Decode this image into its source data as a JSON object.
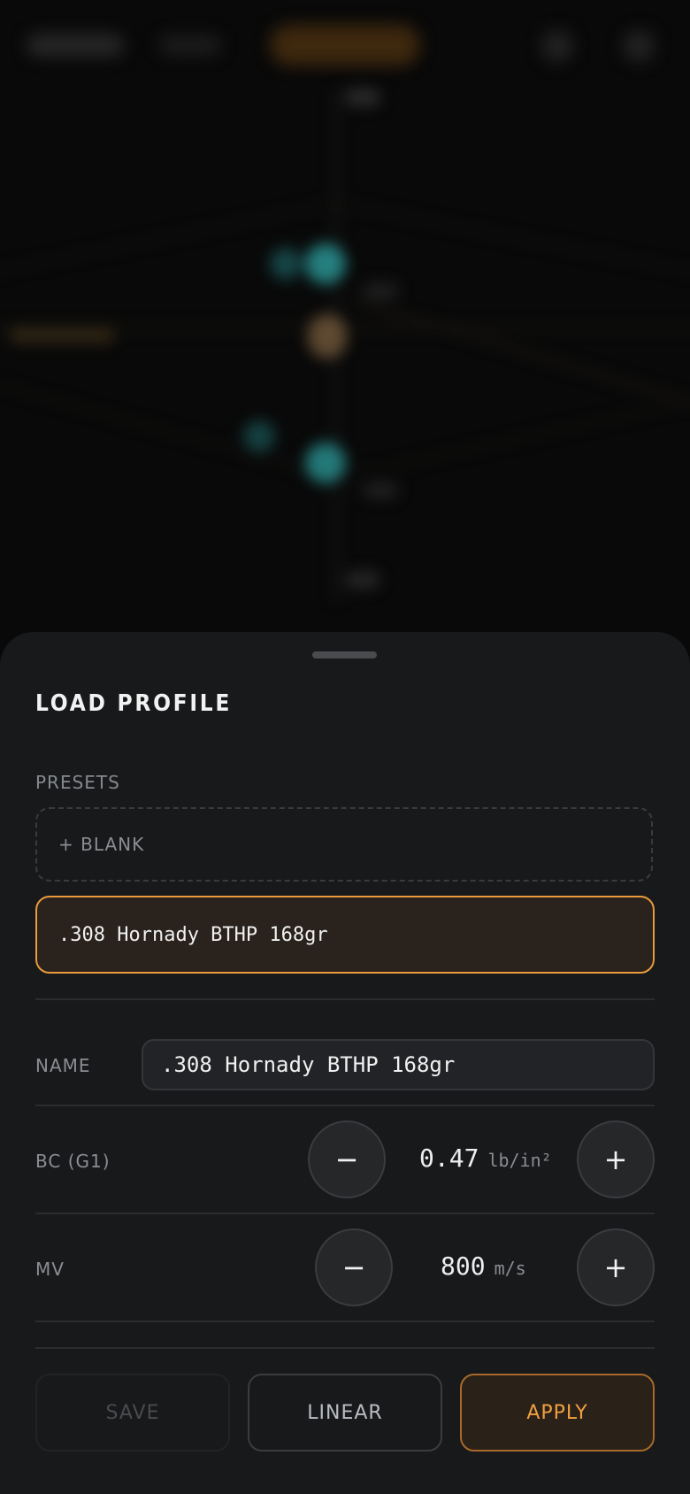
{
  "sheet": {
    "title": "LOAD PROFILE",
    "presets_label": "PRESETS",
    "blank_preset_label": "+ BLANK",
    "selected_preset": ".308 Hornady BTHP 168gr"
  },
  "fields": {
    "name": {
      "label": "NAME",
      "value": ".308 Hornady BTHP 168gr"
    },
    "bc": {
      "label": "BC (G1)",
      "value": "0.47",
      "unit": "lb/in²",
      "minus": "−",
      "plus": "+"
    },
    "mv": {
      "label": "MV",
      "value": "800",
      "unit": "m/s",
      "minus": "−",
      "plus": "+"
    }
  },
  "actions": {
    "save": "SAVE",
    "linear": "LINEAR",
    "apply": "APPLY"
  },
  "colors": {
    "accent": "#e89a3c",
    "sheet_bg": "#18191b",
    "reticle_teal": "#3ab0b0"
  }
}
